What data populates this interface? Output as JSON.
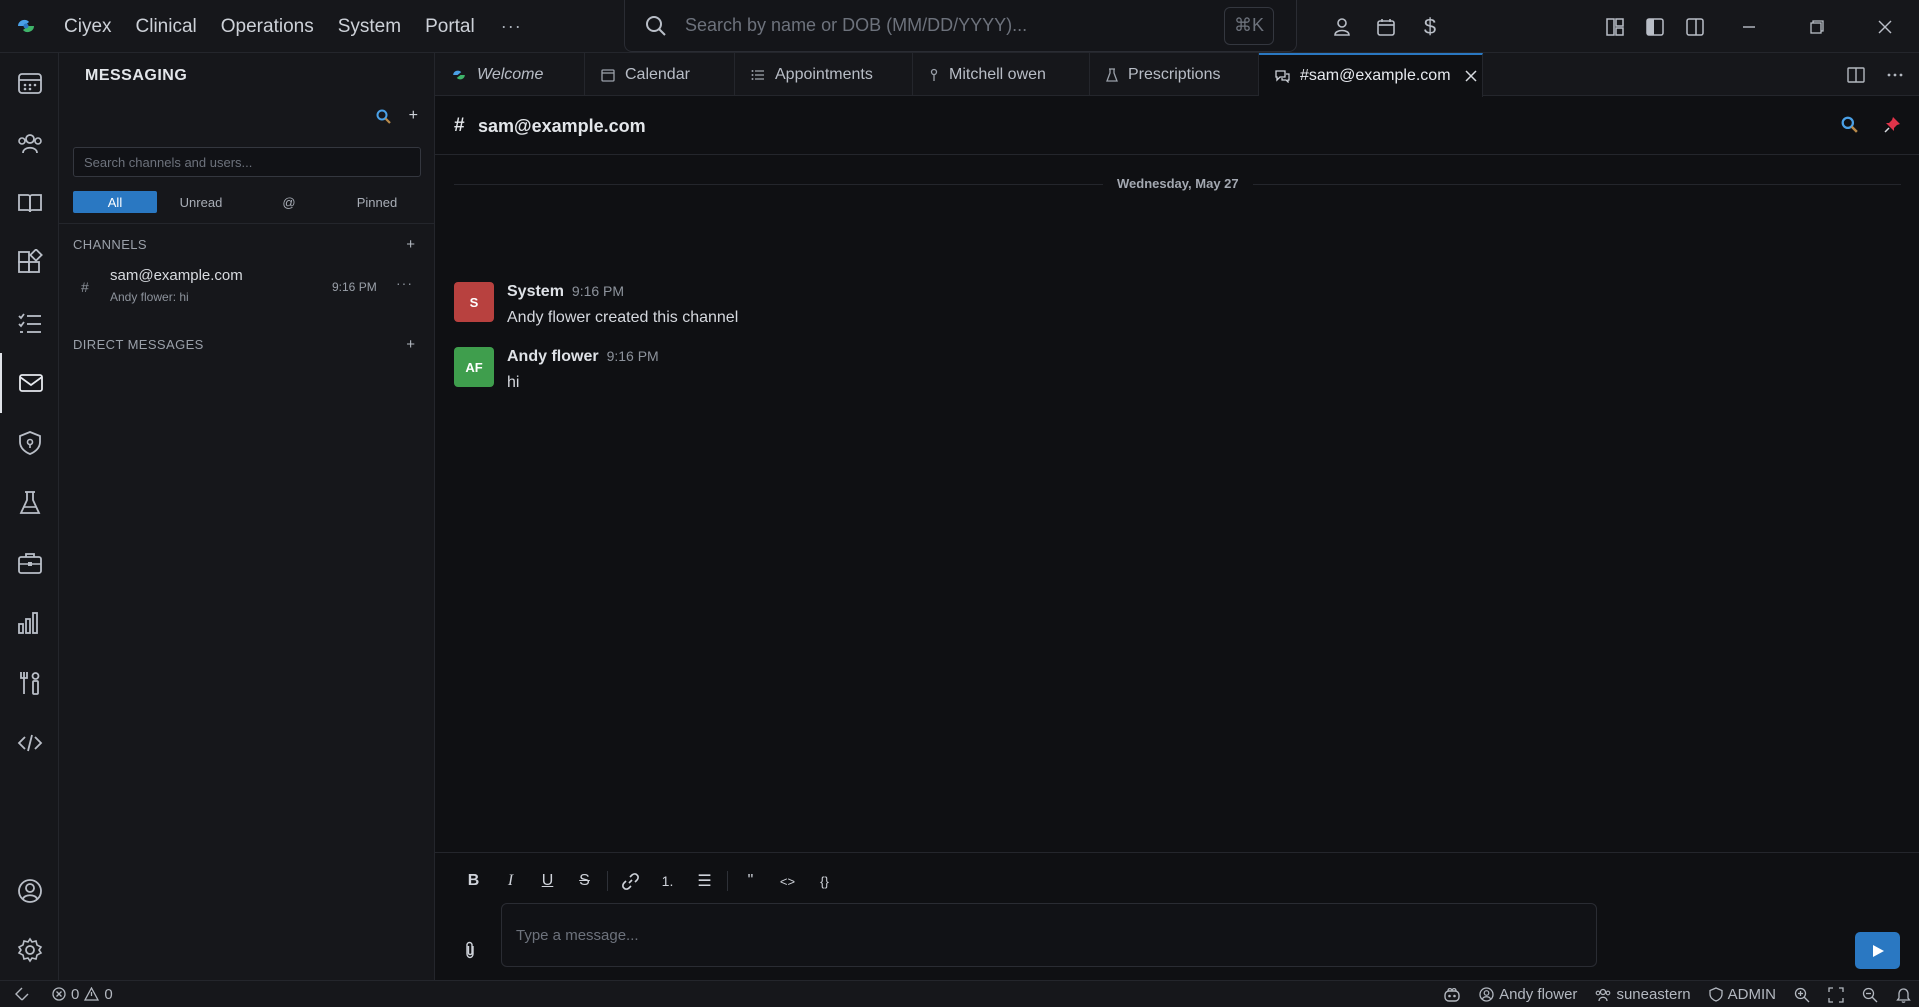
{
  "titlebar": {
    "menu": [
      "Ciyex",
      "Clinical",
      "Operations",
      "System",
      "Portal"
    ],
    "more": "···",
    "search_placeholder": "Search by name or DOB (MM/DD/YYYY)...",
    "search_shortcut": "⌘K",
    "currency_symbol": "$"
  },
  "sidebar": {
    "title": "MESSAGING",
    "search_placeholder": "Search channels and users...",
    "filters": [
      "All",
      "Unread",
      "@",
      "Pinned"
    ],
    "channels_label": "CHANNELS",
    "direct_messages_label": "DIRECT MESSAGES",
    "add": "+",
    "channels": [
      {
        "hash": "#",
        "name": "sam@example.com",
        "preview": "Andy flower: hi",
        "time": "9:16 PM",
        "more": "···"
      }
    ]
  },
  "tabs": [
    {
      "label": "Welcome",
      "icon": "ciyex-logo-icon"
    },
    {
      "label": "Calendar",
      "icon": "calendar-icon"
    },
    {
      "label": "Appointments",
      "icon": "list-icon"
    },
    {
      "label": "Mitchell owen",
      "icon": "person-icon"
    },
    {
      "label": "Prescriptions",
      "icon": "flask-icon"
    },
    {
      "label": "#sam@example.com",
      "icon": "chat-icon"
    }
  ],
  "channel": {
    "hash": "#",
    "name": "sam@example.com",
    "date_separator": "Wednesday, May 27",
    "messages": [
      {
        "initials": "S",
        "author": "System",
        "time": "9:16 PM",
        "text": "Andy flower created this channel",
        "color": "#b8413f"
      },
      {
        "initials": "AF",
        "author": "Andy flower",
        "time": "9:16 PM",
        "text": "hi",
        "color": "#3f9e4d"
      }
    ]
  },
  "composer": {
    "format_buttons": [
      "B",
      "I",
      "U",
      "S",
      "link",
      "1.",
      "☰",
      "\"",
      "<>",
      "{}"
    ],
    "placeholder": "Type a message..."
  },
  "statusbar": {
    "errors": "0",
    "warnings": "0",
    "user": "Andy flower",
    "org": "suneastern",
    "role": "ADMIN"
  },
  "colors": {
    "accent": "#2a78c2",
    "background": "#0f1013",
    "panel": "#16171b"
  }
}
